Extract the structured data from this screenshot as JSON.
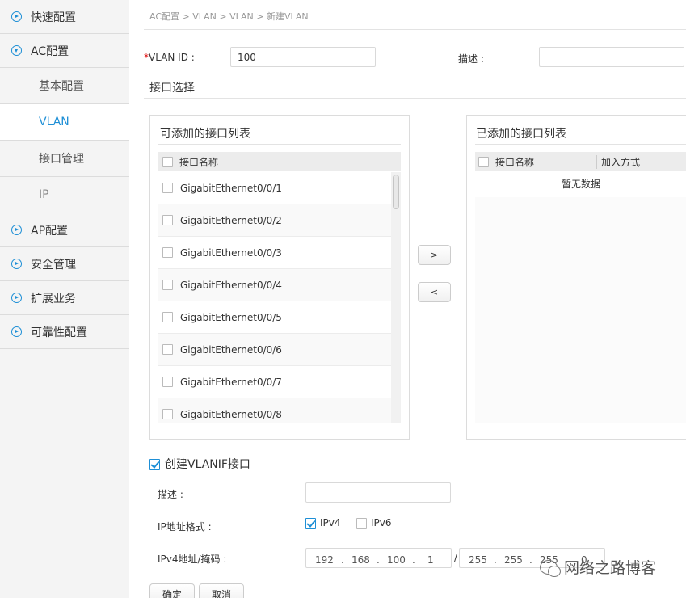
{
  "sidebar": {
    "items": [
      {
        "label": "快速配置"
      },
      {
        "label": "AC配置"
      },
      {
        "label": "基本配置"
      },
      {
        "label": "VLAN"
      },
      {
        "label": "接口管理"
      },
      {
        "label": "IP"
      },
      {
        "label": "AP配置"
      },
      {
        "label": "安全管理"
      },
      {
        "label": "扩展业务"
      },
      {
        "label": "可靠性配置"
      }
    ]
  },
  "breadcrumb": "AC配置 > VLAN > VLAN > 新建VLAN",
  "form": {
    "vlan_id_required_mark": "*",
    "vlan_id_label": "VLAN ID :",
    "vlan_id_value": "100",
    "desc_label": "描述 :",
    "desc_value": ""
  },
  "interface_section_title": "接口选择",
  "available": {
    "title": "可添加的接口列表",
    "col_name": "接口名称",
    "rows": [
      "GigabitEthernet0/0/1",
      "GigabitEthernet0/0/2",
      "GigabitEthernet0/0/3",
      "GigabitEthernet0/0/4",
      "GigabitEthernet0/0/5",
      "GigabitEthernet0/0/6",
      "GigabitEthernet0/0/7",
      "GigabitEthernet0/0/8"
    ]
  },
  "added": {
    "title": "已添加的接口列表",
    "col_name": "接口名称",
    "col_mode": "加入方式",
    "empty_text": "暂无数据"
  },
  "move": {
    "add_label": ">",
    "remove_label": "<"
  },
  "vlanif": {
    "create_label": "创建VLANIF接口",
    "create_checked": true,
    "desc_label": "描述 :",
    "desc_value": "",
    "ip_format_label": "IP地址格式 :",
    "ipv4_label": "IPv4",
    "ipv4_checked": true,
    "ipv6_label": "IPv6",
    "ipv6_checked": false,
    "addr_label": "IPv4地址/掩码 :",
    "ip": [
      "192",
      "168",
      "100",
      "1"
    ],
    "mask_slash": "/",
    "mask": [
      "255",
      "255",
      "255",
      "0"
    ]
  },
  "buttons": {
    "ok": "确定",
    "cancel": "取消"
  },
  "watermark": "网络之路博客"
}
